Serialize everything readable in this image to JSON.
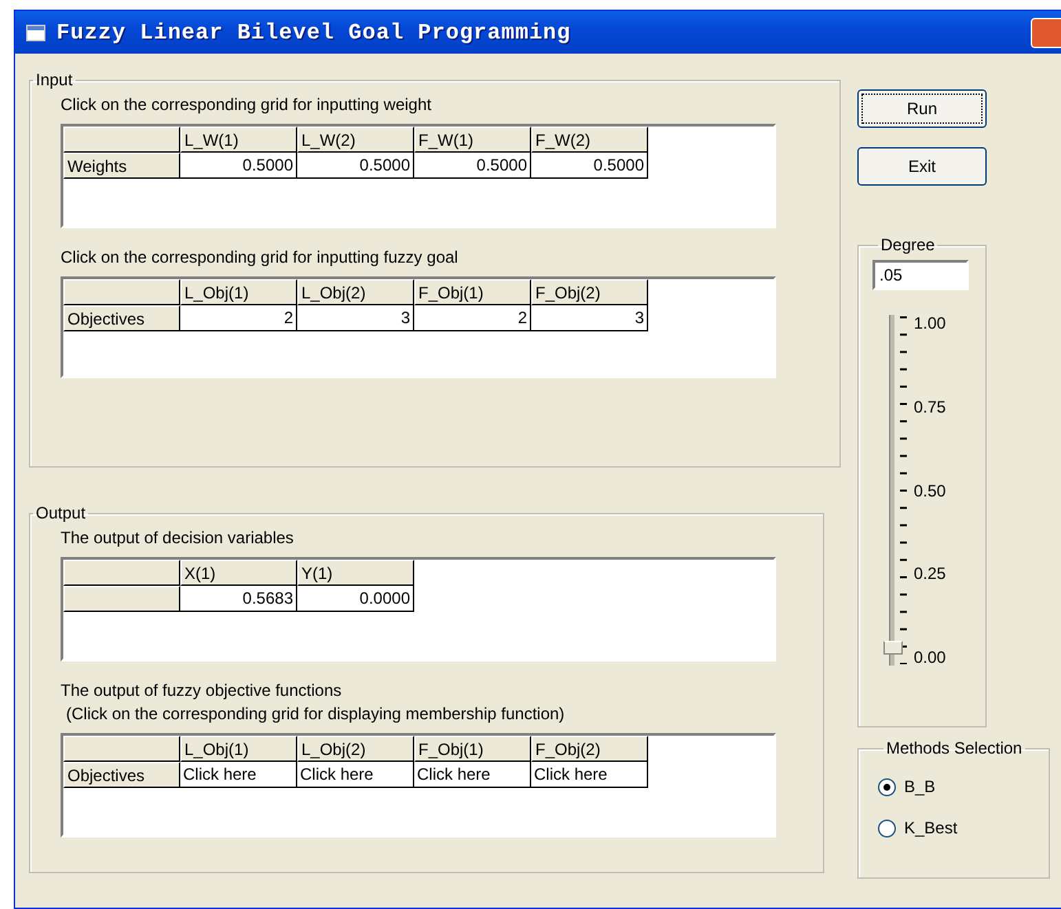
{
  "window": {
    "title": "Fuzzy Linear Bilevel Goal Programming"
  },
  "input": {
    "legend": "Input",
    "grids": [
      {
        "label": "Click on the corresponding grid for inputting weight",
        "kind": "values",
        "columns": [
          "L_W(1)",
          "L_W(2)",
          "F_W(1)",
          "F_W(2)"
        ],
        "rows": [
          {
            "header": "Weights",
            "cells": [
              "0.5000",
              "0.5000",
              "0.5000",
              "0.5000"
            ]
          }
        ]
      },
      {
        "label": "Click on the corresponding grid for inputting fuzzy goal",
        "kind": "values",
        "columns": [
          "L_Obj(1)",
          "L_Obj(2)",
          "F_Obj(1)",
          "F_Obj(2)"
        ],
        "rows": [
          {
            "header": "Objectives",
            "cells": [
              "2",
              "3",
              "2",
              "3"
            ]
          }
        ]
      }
    ]
  },
  "output": {
    "legend": "Output",
    "grids": [
      {
        "label": "The output of decision variables",
        "kind": "values",
        "columns": [
          "X(1)",
          "Y(1)"
        ],
        "rows": [
          {
            "cells": [
              "0.5683",
              "0.0000"
            ]
          }
        ]
      },
      {
        "label": "The output of fuzzy objective functions",
        "note": "(Click on the corresponding grid for displaying membership function)",
        "kind": "links",
        "columns": [
          "L_Obj(1)",
          "L_Obj(2)",
          "F_Obj(1)",
          "F_Obj(2)"
        ],
        "rows": [
          {
            "header": "Objectives",
            "cells": [
              "Click here",
              "Click here",
              "Click here",
              "Click here"
            ]
          }
        ]
      }
    ]
  },
  "buttons": [
    "Run",
    "Exit"
  ],
  "degree": {
    "legend": "Degree",
    "value": ".05",
    "level": 0.05,
    "ticks": [
      "1.00",
      "0.75",
      "0.50",
      "0.25",
      "0.00"
    ]
  },
  "methods": {
    "legend": "Methods Selection",
    "options": [
      {
        "label": "B_B",
        "selected": true
      },
      {
        "label": "K_Best",
        "selected": false
      }
    ]
  }
}
